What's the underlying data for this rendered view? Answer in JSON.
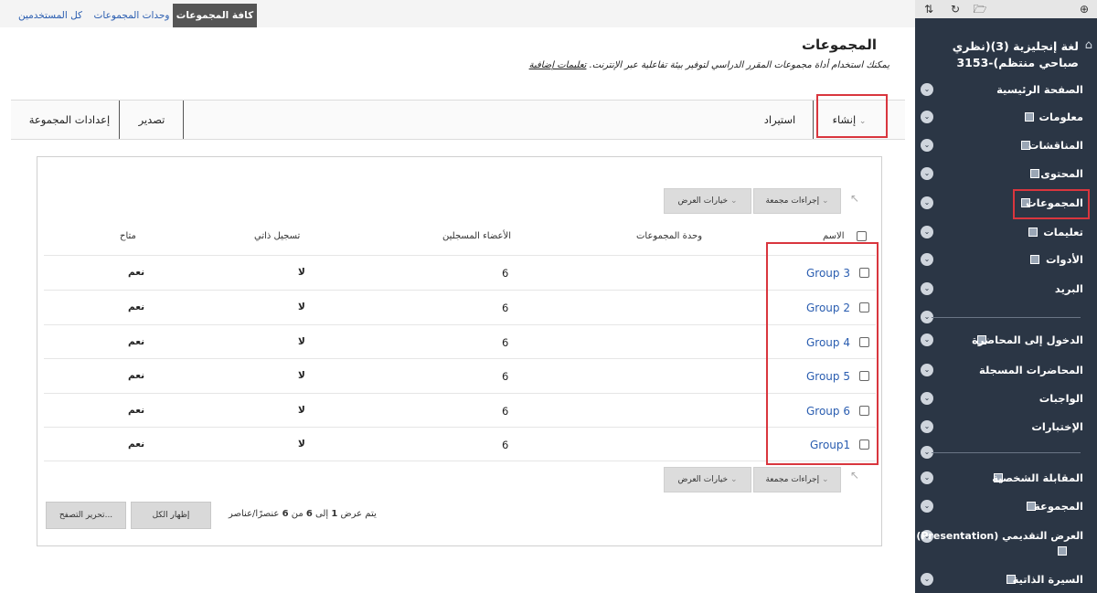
{
  "top_tabs": [
    "كافة المجموعات",
    "وحدات المجموعات",
    "كل المستخدمين"
  ],
  "page": {
    "title": "المجموعات",
    "description": "يمكنك استخدام أداة مجموعات المقرر الدراسي لتوفير بيئة تفاعلية عبر الإنترنت.",
    "help_link": "تعليمات إضافية"
  },
  "action_bar": {
    "create": "إنشاء",
    "import": "استيراد",
    "export": "تصدير",
    "group_settings": "إعدادات المجموعة"
  },
  "list": {
    "bulk_actions": "إجراءات مجمعة",
    "display_options": "خيارات العرض",
    "columns": {
      "name": "الاسم",
      "group_set": "وحدة المجموعات",
      "enrolled": "الأعضاء المسجلين",
      "self_enroll": "تسجيل ذاتي",
      "available": "متاح"
    },
    "rows": [
      {
        "name": "Group 3",
        "enrolled": "6",
        "self_enroll": "لا",
        "available": "نعم"
      },
      {
        "name": "Group 2",
        "enrolled": "6",
        "self_enroll": "لا",
        "available": "نعم"
      },
      {
        "name": "Group 4",
        "enrolled": "6",
        "self_enroll": "لا",
        "available": "نعم"
      },
      {
        "name": "Group 5",
        "enrolled": "6",
        "self_enroll": "لا",
        "available": "نعم"
      },
      {
        "name": "Group 6",
        "enrolled": "6",
        "self_enroll": "لا",
        "available": "نعم"
      },
      {
        "name": "Group1",
        "enrolled": "6",
        "self_enroll": "لا",
        "available": "نعم"
      }
    ],
    "pager": {
      "prefix": "يتم عرض",
      "from": "1",
      "to_word": "إلى",
      "to": "6",
      "of_word": "من",
      "total": "6",
      "suffix": "عنصرًا/عناصر"
    },
    "show_all": "إظهار الكل",
    "edit_paging": "تحرير التصفح..."
  },
  "sidebar": {
    "course_title": "لغة إنجليزية (3)(نظري صباحي منتظم)-3153",
    "items": [
      "الصفحة الرئيسية",
      "معلومات",
      "المناقشات",
      "المحتوى",
      "المجموعات",
      "تعليمات",
      "الأدوات",
      "البريد",
      "الدخول إلى المحاضرة",
      "المحاضرات المسجلة",
      "الواجبات",
      "الإختبارات",
      "المقابلة الشخصية",
      "المجموعة",
      "العرض التقديمي (Presentation)",
      "السيرة الذاتية"
    ]
  },
  "colors": {
    "sidebar_bg": "#2b3645",
    "active_tab": "#555555",
    "link": "#2a5db0",
    "highlight": "#d9363e"
  }
}
